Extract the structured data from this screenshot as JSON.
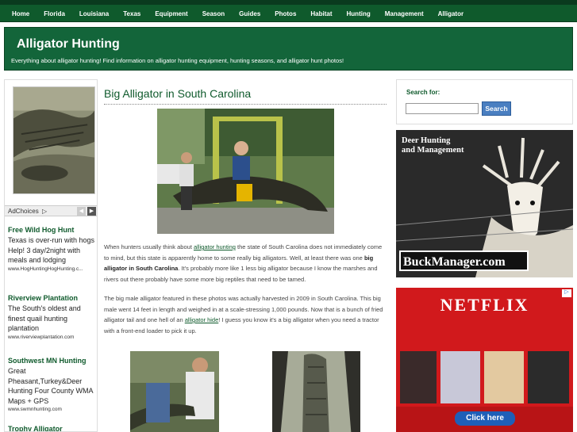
{
  "nav": {
    "items": [
      "Home",
      "Florida",
      "Louisiana",
      "Texas",
      "Equipment",
      "Season",
      "Guides",
      "Photos",
      "Habitat",
      "Hunting",
      "Management",
      "Alligator"
    ]
  },
  "banner": {
    "title": "Alligator Hunting",
    "tagline": "Everything about alligator hunting! Find information on alligator hunting equipment, hunting seasons, and alligator hunt photos!"
  },
  "left_ads": {
    "adchoices_label": "AdChoices",
    "ads": [
      {
        "title": "Free Wild Hog Hunt",
        "body": "Texas is over-run with hogs Help! 3 day/2night with meals and lodging",
        "url": "www.HogHuntingHogHunting.c..."
      },
      {
        "title": "Riverview Plantation",
        "body": "The South's oldest and finest quail hunting plantation",
        "url": "www.riverviewplantation.com"
      },
      {
        "title": "Southwest MN Hunting",
        "body": "Great Pheasant,Turkey&Deer Hunting Four County WMA Maps + GPS",
        "url": "www.swmnhunting.com"
      },
      {
        "title": "Trophy Alligator",
        "body": "",
        "url": ""
      }
    ]
  },
  "article": {
    "title": "Big Alligator in South Carolina",
    "p1_a": "When hunters usually think about ",
    "p1_link": "alligator hunting",
    "p1_b": " the state of South Carolina does not immediately come to mind, but this state is apparently home to some really big alligators. Well, at least there was one ",
    "p1_bold": "big alligator in South Carolina",
    "p1_c": ". It's probably more like 1 less big alligator because I know the marshes and rivers out there probably have some more big reptiles that need to be tamed.",
    "p2_a": "The big male alligator featured in these photos was actually harvested in 2009 in South Carolina. This big male went 14 feet in length and weighed in at a scale-stressing 1,000 pounds. Now that is a bunch of fried alligator tail and one hell of an ",
    "p2_link": "alligator hide",
    "p2_b": "! I guess you know it's a big alligator when you need a tractor with a front-end loader to pick it up."
  },
  "sidebar": {
    "search_label": "Search for:",
    "search_value": "",
    "search_button": "Search",
    "deer_ad": {
      "line1": "Deer Hunting",
      "line2": "and Management",
      "brand": "BuckManager.com"
    },
    "netflix_ad": {
      "brand": "NETFLIX",
      "cta": "Click here"
    }
  },
  "colors": {
    "nav": "#0f5a2c",
    "banner": "#13653a",
    "accent": "#0f5a2c",
    "search_button": "#4a7fc1",
    "netflix_red": "#d1191c"
  }
}
